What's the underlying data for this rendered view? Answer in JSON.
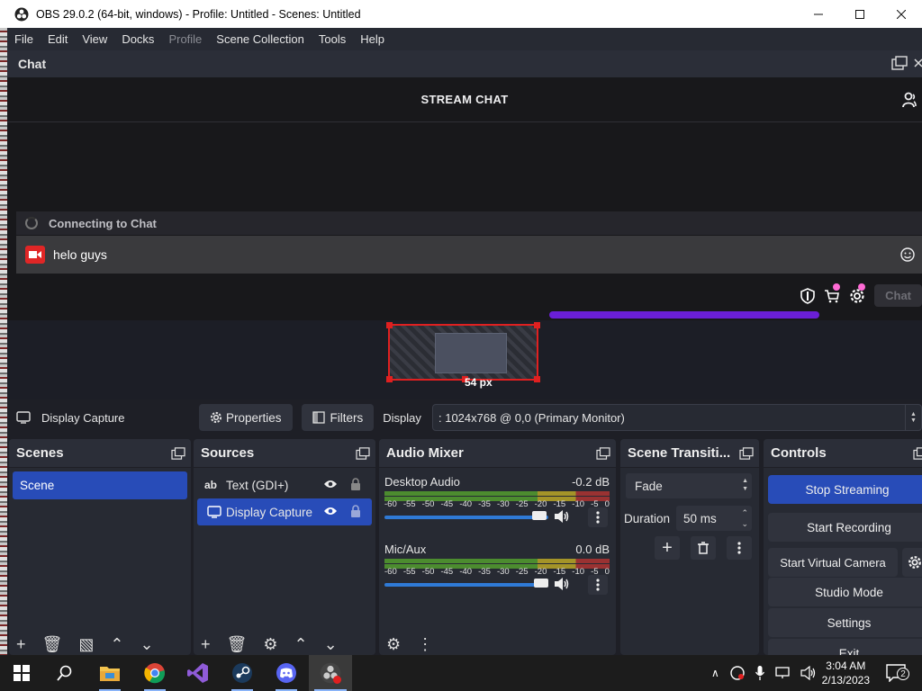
{
  "window": {
    "title": "OBS 29.0.2 (64-bit, windows) - Profile: Untitled - Scenes: Untitled"
  },
  "menu": [
    "File",
    "Edit",
    "View",
    "Docks",
    "Profile",
    "Scene Collection",
    "Tools",
    "Help"
  ],
  "chat": {
    "dock_title": "Chat",
    "header": "STREAM CHAT",
    "connecting": "Connecting to Chat",
    "message": "helo guys",
    "chat_button": "Chat"
  },
  "preview": {
    "size_label": "54 px"
  },
  "source_toolbar": {
    "selected_source": "Display Capture",
    "properties": "Properties",
    "filters": "Filters",
    "display_label": "Display",
    "display_value": ": 1024x768 @ 0,0 (Primary Monitor)"
  },
  "docks": {
    "scenes": {
      "title": "Scenes",
      "items": [
        "Scene"
      ]
    },
    "sources": {
      "title": "Sources",
      "items": [
        "Text (GDI+)",
        "Display Capture"
      ]
    },
    "mixer": {
      "title": "Audio Mixer",
      "ticks": [
        "-60",
        "-55",
        "-50",
        "-45",
        "-40",
        "-35",
        "-30",
        "-25",
        "-20",
        "-15",
        "-10",
        "-5",
        "0"
      ],
      "channels": [
        {
          "name": "Desktop Audio",
          "db": "-0.2 dB"
        },
        {
          "name": "Mic/Aux",
          "db": "0.0 dB"
        }
      ]
    },
    "transitions": {
      "title": "Scene Transiti...",
      "type": "Fade",
      "duration_label": "Duration",
      "duration_value": "50 ms"
    },
    "controls": {
      "title": "Controls",
      "buttons": [
        "Stop Streaming",
        "Start Recording",
        "Start Virtual Camera",
        "Studio Mode",
        "Settings",
        "Exit"
      ]
    }
  },
  "taskbar": {
    "time": "3:04 AM",
    "date": "2/13/2023",
    "notifications": "2"
  }
}
